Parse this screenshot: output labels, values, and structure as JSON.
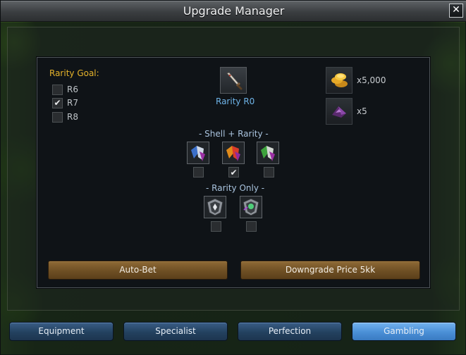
{
  "window": {
    "title": "Upgrade Manager",
    "close_glyph": "✕"
  },
  "rarity_goal": {
    "label": "Rarity Goal:",
    "options": [
      {
        "label": "R6",
        "checked": false
      },
      {
        "label": "R7",
        "checked": true
      },
      {
        "label": "R8",
        "checked": false
      }
    ]
  },
  "item": {
    "icon": "sword-icon",
    "rarity_label": "Rarity R0"
  },
  "costs": [
    {
      "icon": "gold-coins-icon",
      "amount": "x5,000"
    },
    {
      "icon": "purple-gem-icon",
      "amount": "x5"
    }
  ],
  "shell_rarity": {
    "label": "-  Shell + Rarity  -",
    "scrolls": [
      {
        "icon": "blue-scroll-icon",
        "checked": false
      },
      {
        "icon": "red-scroll-icon",
        "checked": true
      },
      {
        "icon": "green-scroll-icon",
        "checked": false
      }
    ]
  },
  "rarity_only": {
    "label": "-  Rarity Only  -",
    "amulets": [
      {
        "icon": "white-shield-icon",
        "checked": false
      },
      {
        "icon": "green-shield-icon",
        "checked": false
      }
    ]
  },
  "actions": {
    "auto_bet": "Auto-Bet",
    "downgrade": "Downgrade Price 5kk"
  },
  "tabs": [
    {
      "label": "Equipment",
      "active": false
    },
    {
      "label": "Specialist",
      "active": false
    },
    {
      "label": "Perfection",
      "active": false
    },
    {
      "label": "Gambling",
      "active": true
    }
  ],
  "colors": {
    "goal_label": "#e6b32a",
    "rarity_label": "#6fb4e8",
    "action_button": "#7b5a2b",
    "tab": "#2a4b6e",
    "tab_active": "#4a8fd6"
  }
}
